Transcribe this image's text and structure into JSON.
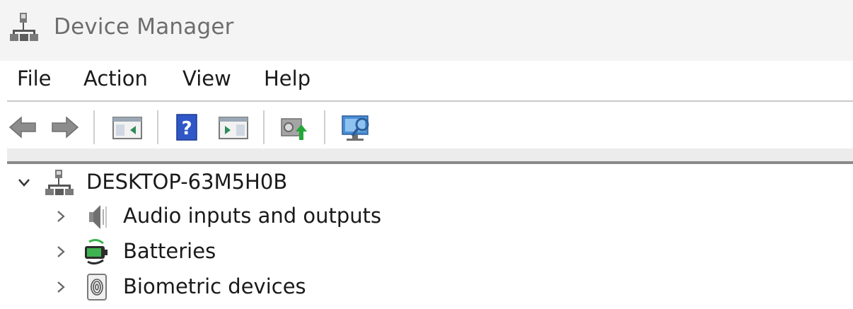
{
  "window": {
    "title": "Device Manager",
    "title_icon": "computer-network-icon"
  },
  "menu": {
    "items": [
      {
        "label": "File"
      },
      {
        "label": "Action"
      },
      {
        "label": "View"
      },
      {
        "label": "Help"
      }
    ]
  },
  "toolbar": {
    "buttons": [
      {
        "name": "back-arrow-icon"
      },
      {
        "name": "forward-arrow-icon"
      },
      {
        "name": "show-hide-console-tree-icon"
      },
      {
        "name": "help-icon"
      },
      {
        "name": "action-pane-icon"
      },
      {
        "name": "update-driver-icon"
      },
      {
        "name": "scan-hardware-changes-icon"
      }
    ]
  },
  "tree": {
    "root": {
      "label": "DESKTOP-63M5H0B",
      "expanded": true,
      "icon": "computer-network-icon"
    },
    "children": [
      {
        "label": "Audio inputs and outputs",
        "icon": "speaker-icon",
        "expanded": false
      },
      {
        "label": "Batteries",
        "icon": "battery-icon",
        "expanded": false
      },
      {
        "label": "Biometric devices",
        "icon": "fingerprint-icon",
        "expanded": false
      }
    ]
  },
  "colors": {
    "titlebar_bg": "#f4f4f4",
    "title_text": "#6d6d6d",
    "menu_text": "#1a1a1a",
    "separator": "#c9c9c9"
  }
}
